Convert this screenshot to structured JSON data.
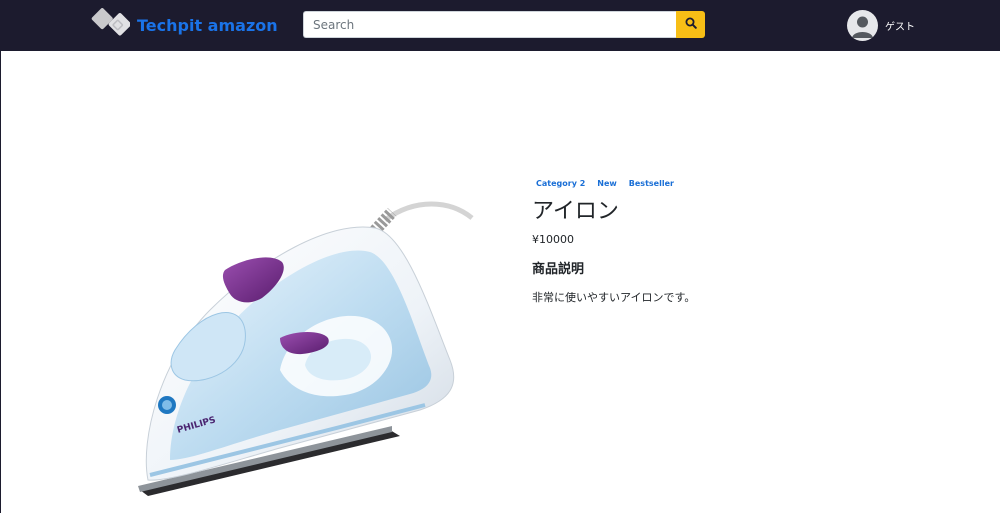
{
  "header": {
    "brand_name": "Techpit amazon",
    "search_placeholder": "Search",
    "search_value": "",
    "user_name": "ゲスト"
  },
  "product": {
    "badges": [
      "Category 2",
      "New",
      "Bestseller"
    ],
    "title": "アイロン",
    "price": "¥10000",
    "description_heading": "商品説明",
    "description": "非常に使いやすいアイロンです。",
    "image_brand_text": "PHILIPS"
  },
  "colors": {
    "navbar_bg": "#1c1b2e",
    "brand_text": "#1a73e8",
    "search_button": "#f7be16",
    "badge_text": "#1a6fd6"
  },
  "icons": {
    "search_button_icon": "search-icon",
    "avatar_icon": "user-avatar-icon",
    "brand_logo": "logo-icon"
  }
}
